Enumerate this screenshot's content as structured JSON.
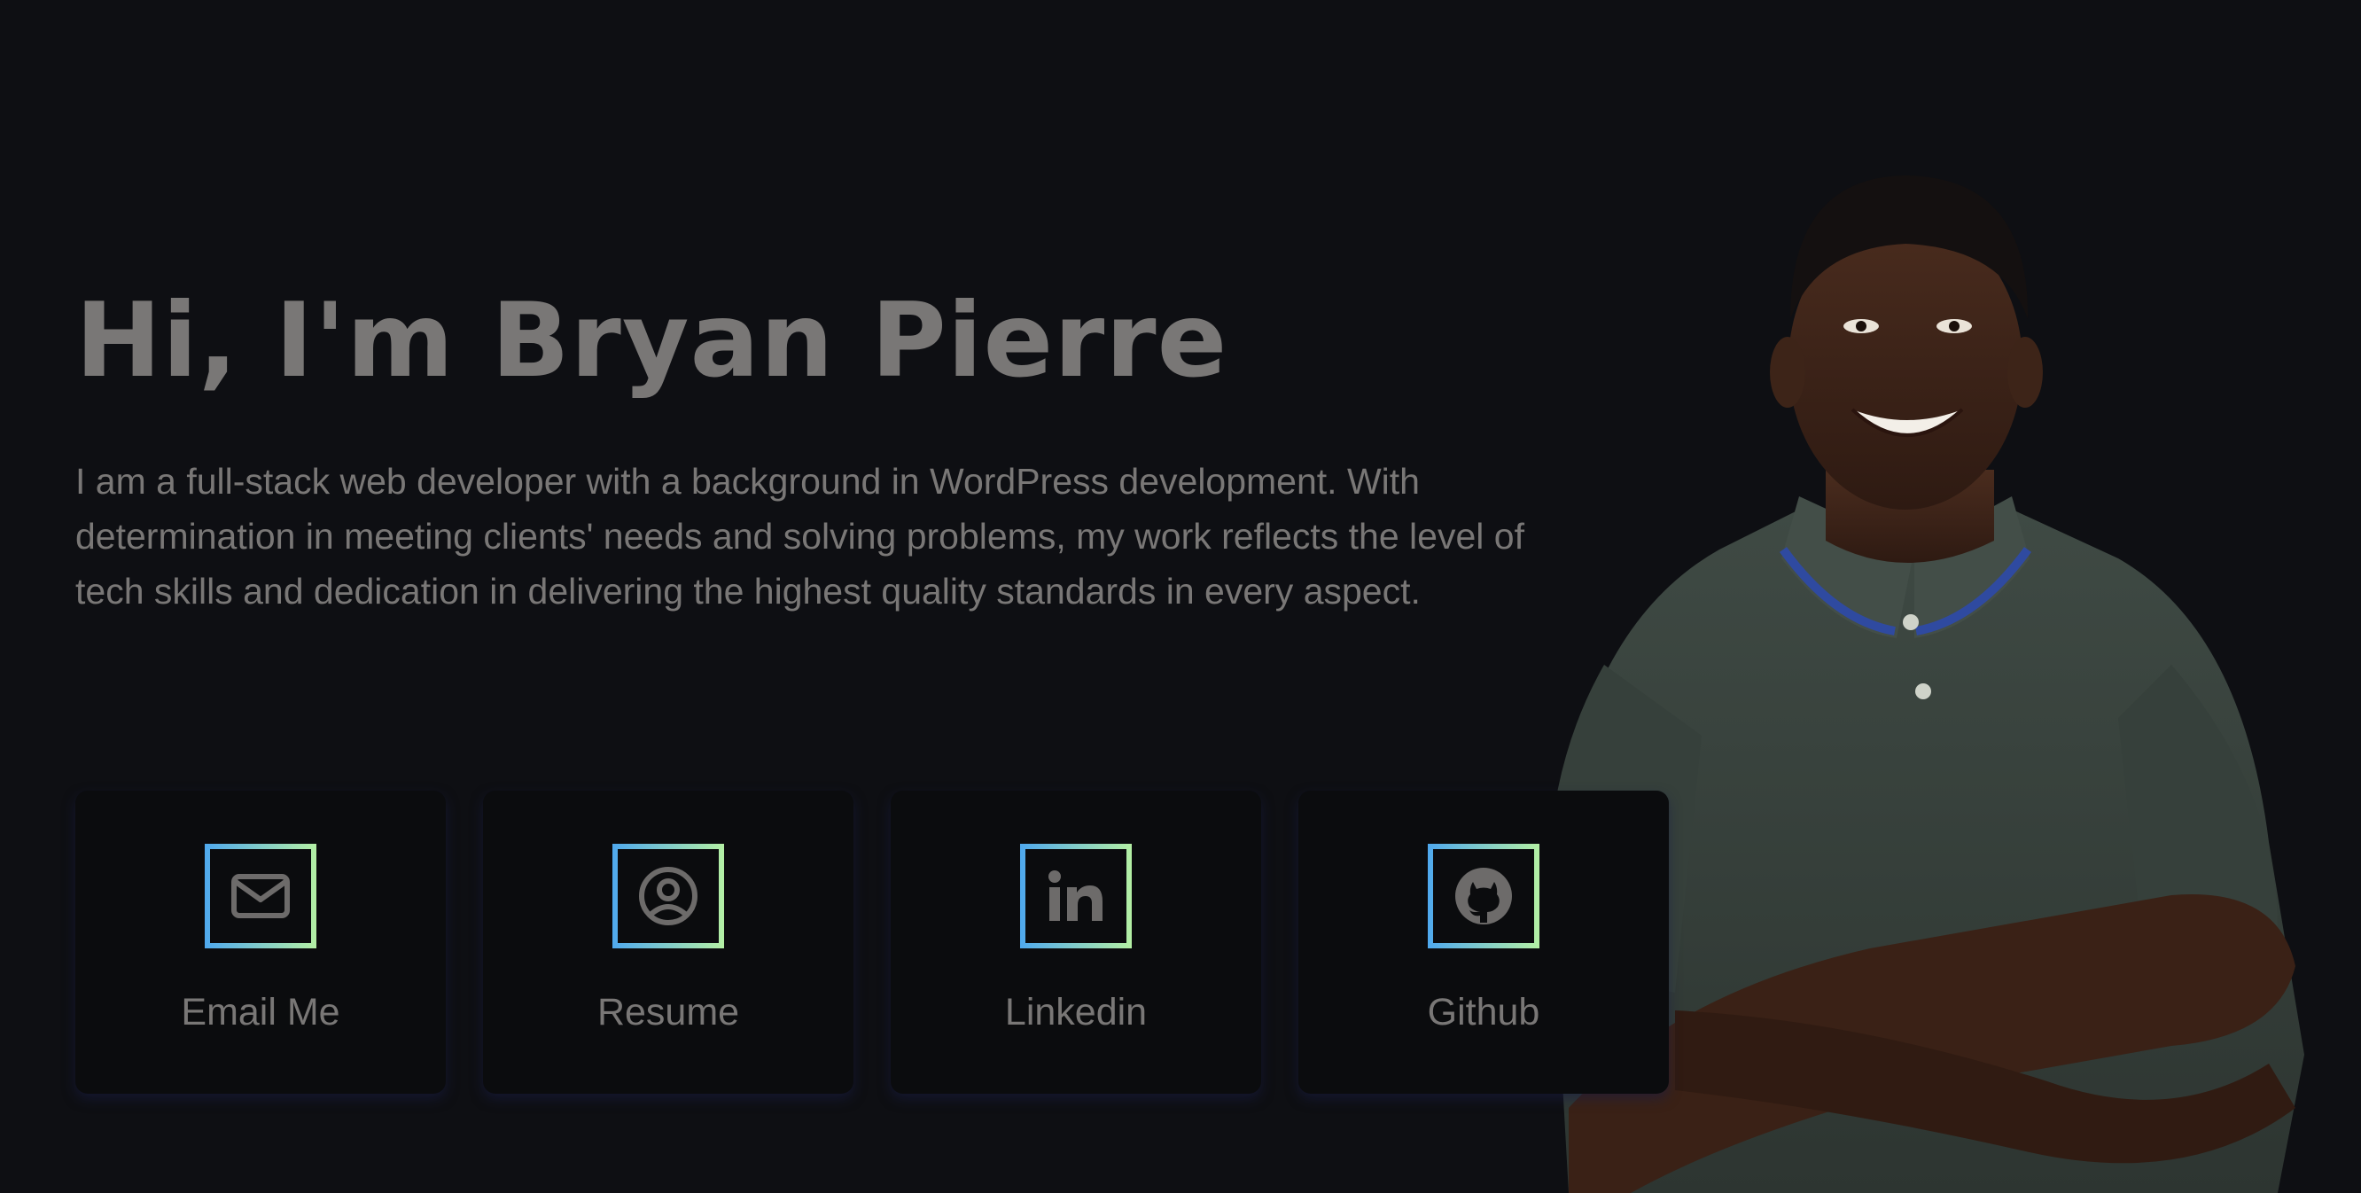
{
  "hero": {
    "title": "Hi, I'm Bryan Pierre",
    "bio": "I am a full-stack web developer with a background in WordPress development. With determination in meeting clients' needs and solving problems, my work reflects the level of tech skills and dedication in delivering the highest quality standards in every aspect."
  },
  "cards": [
    {
      "label": "Email Me",
      "icon": "envelope-icon"
    },
    {
      "label": "Resume",
      "icon": "user-circle-icon"
    },
    {
      "label": "Linkedin",
      "icon": "linkedin-icon"
    },
    {
      "label": "Github",
      "icon": "github-icon"
    }
  ],
  "colors": {
    "background": "#0e0f13",
    "card": "#0b0c0e",
    "text": "#797776",
    "gradient_start": "#4fa9ee",
    "gradient_end": "#b4f0a4"
  }
}
